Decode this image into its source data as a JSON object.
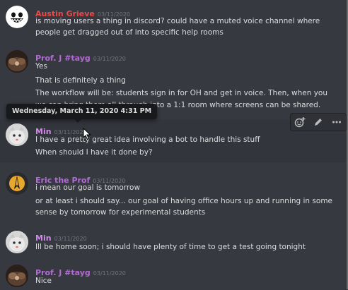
{
  "tooltip": "Wednesday, March 11, 2020 4:31 PM",
  "messages": [
    {
      "author": "Austin Grieve",
      "color": "#f04747",
      "ts": "03/11/2020",
      "lines": [
        "is moving users a thing in discord? could have a muted voice channel where",
        "people get dragged out of into specific help rooms"
      ]
    },
    {
      "author": "Prof. J #tayg",
      "color": "#b36bd6",
      "ts": "03/11/2020",
      "lines": [
        "Yes",
        "That is definitely a thing",
        "The workflow will be:  students sign in for OH and get in voice.  Then, when you",
        "we can bring them all through into a 1:1 room where screens can be shared."
      ]
    },
    {
      "author": "Min",
      "color": "#cf8be4",
      "ts": "03/11/2020",
      "lines": [
        "I have a pretty great idea involving a bot to handle this stuff",
        "When should I have it done by?"
      ]
    },
    {
      "author": "Eric the Prof",
      "color": "#b36bd6",
      "ts": "03/11/2020",
      "lines": [
        "i mean our goal is tomorrow",
        "or at least i should say... our goal of having office hours up and running in some",
        "sense by tomorrow for experimental students"
      ]
    },
    {
      "author": "Min",
      "color": "#cf8be4",
      "ts": "03/11/2020",
      "lines": [
        "Ill be home soon; i should have plenty of time to get a test going tonight"
      ]
    },
    {
      "author": "Prof. J #tayg",
      "color": "#b36bd6",
      "ts": "03/11/2020",
      "lines": [
        "Nice"
      ]
    }
  ],
  "icons": {
    "react": "add-reaction-icon",
    "edit": "pencil-icon",
    "more": "ellipsis-icon"
  }
}
